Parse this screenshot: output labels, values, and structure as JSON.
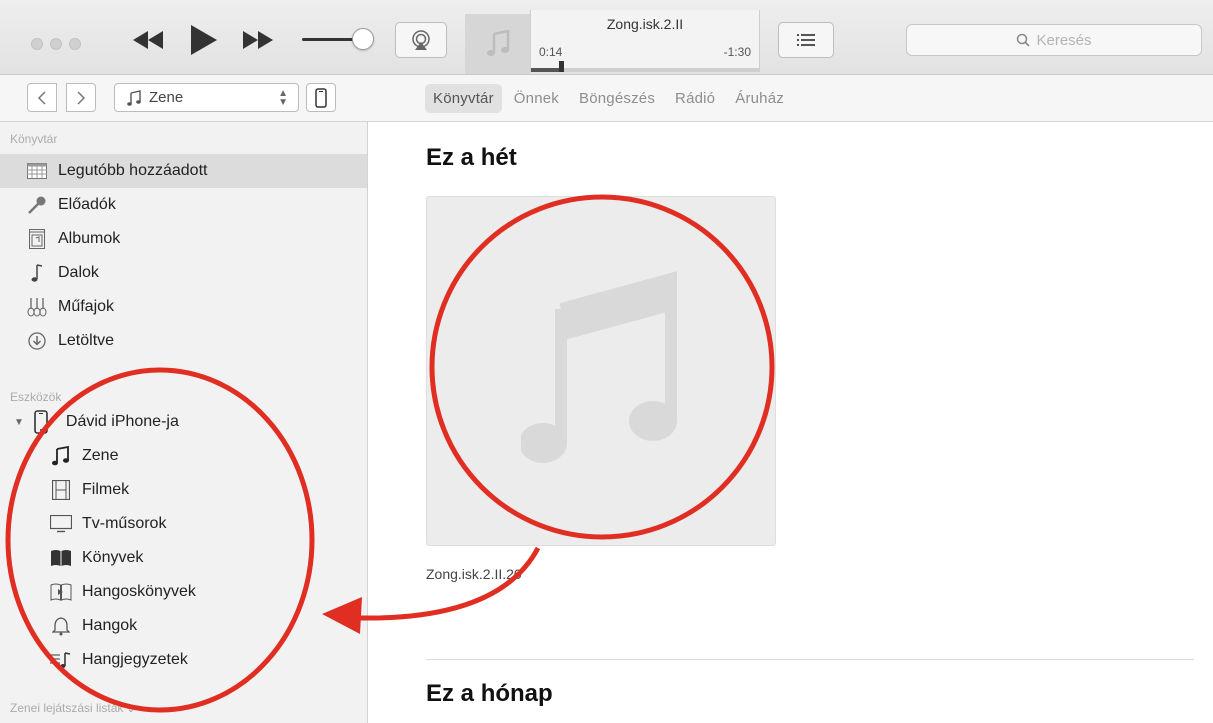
{
  "player": {
    "track_title": "Zong.isk.2.II",
    "elapsed": "0:14",
    "remaining": "-1:30",
    "progress": 0.13
  },
  "search": {
    "placeholder": "Keresés"
  },
  "media_selector": {
    "value": "Zene"
  },
  "tabs": [
    {
      "label": "Könyvtár",
      "active": true
    },
    {
      "label": "Önnek"
    },
    {
      "label": "Böngészés"
    },
    {
      "label": "Rádió"
    },
    {
      "label": "Áruház"
    }
  ],
  "sidebar": {
    "library_heading": "Könyvtár",
    "library_items": [
      {
        "label": "Legutóbb hozzáadott",
        "icon": "grid-icon",
        "selected": true
      },
      {
        "label": "Előadók",
        "icon": "microphone-icon"
      },
      {
        "label": "Albumok",
        "icon": "album-icon"
      },
      {
        "label": "Dalok",
        "icon": "note-icon"
      },
      {
        "label": "Műfajok",
        "icon": "guitars-icon"
      },
      {
        "label": "Letöltve",
        "icon": "download-icon"
      }
    ],
    "devices_heading": "Eszközök",
    "device_name": "Dávid iPhone-ja",
    "device_items": [
      {
        "label": "Zene",
        "icon": "music-icon"
      },
      {
        "label": "Filmek",
        "icon": "film-icon"
      },
      {
        "label": "Tv-műsorok",
        "icon": "tv-icon"
      },
      {
        "label": "Könyvek",
        "icon": "book-icon"
      },
      {
        "label": "Hangoskönyvek",
        "icon": "audiobook-icon"
      },
      {
        "label": "Hangok",
        "icon": "bell-icon"
      },
      {
        "label": "Hangjegyzetek",
        "icon": "voice-memo-icon"
      }
    ],
    "playlists_heading": "Zenei lejátszási listák"
  },
  "main": {
    "section_week": "Ez a hét",
    "album_caption": "Zong.isk.2.II.20",
    "section_month": "Ez a hónap"
  },
  "colors": {
    "annotation_red": "#e02f22",
    "sidebar_bg": "#f2f2f2",
    "selected_row": "#dcdcdc"
  }
}
